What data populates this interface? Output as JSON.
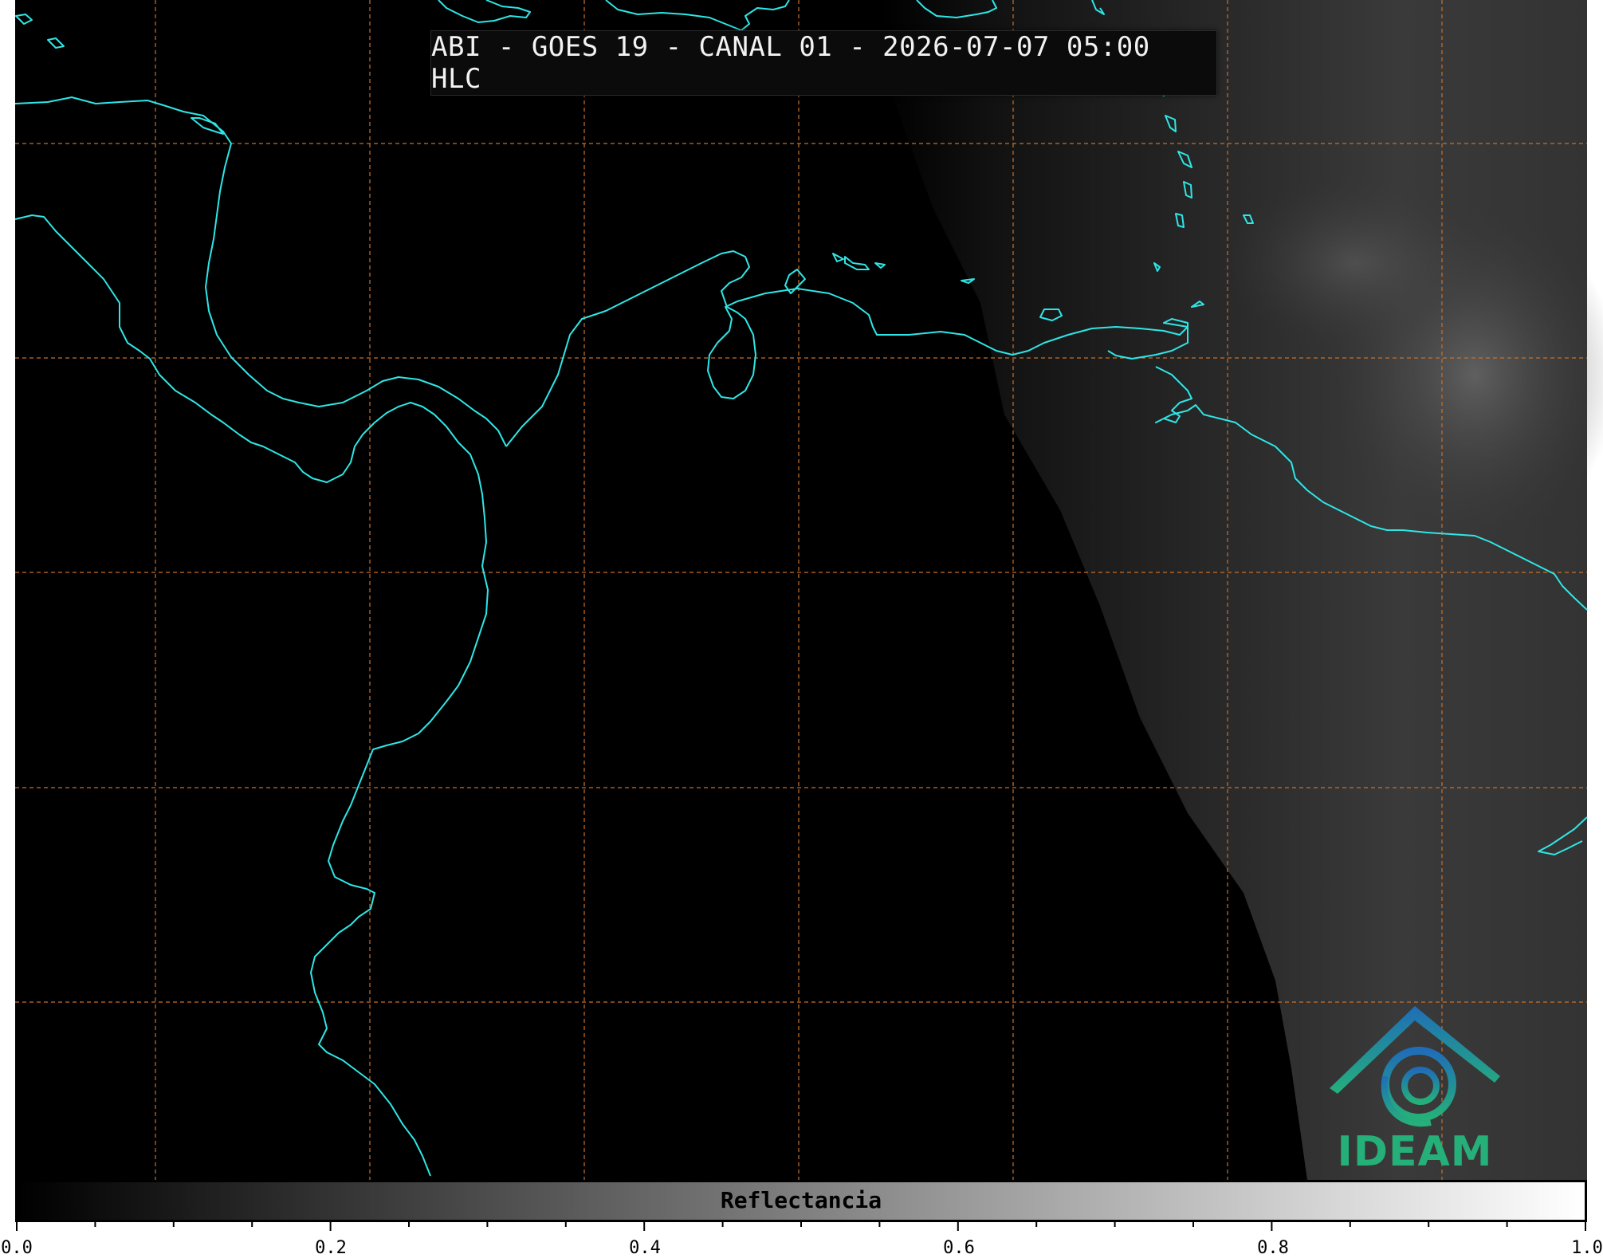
{
  "map": {
    "title": "ABI - GOES 19 - CANAL 01 - 2026-07-07 05:00 HLC",
    "coastline_color": "#2fe6e6",
    "grid_color": "#c8702a",
    "background_color": "#000000"
  },
  "colorbar": {
    "label": "Reflectancia",
    "ticks": [
      "0.0",
      "0.2",
      "0.4",
      "0.6",
      "0.8",
      "1.0"
    ],
    "range": [
      0.0,
      1.0
    ],
    "colormap": "grayscale black-to-white"
  },
  "logo": {
    "text": "IDEAM"
  }
}
